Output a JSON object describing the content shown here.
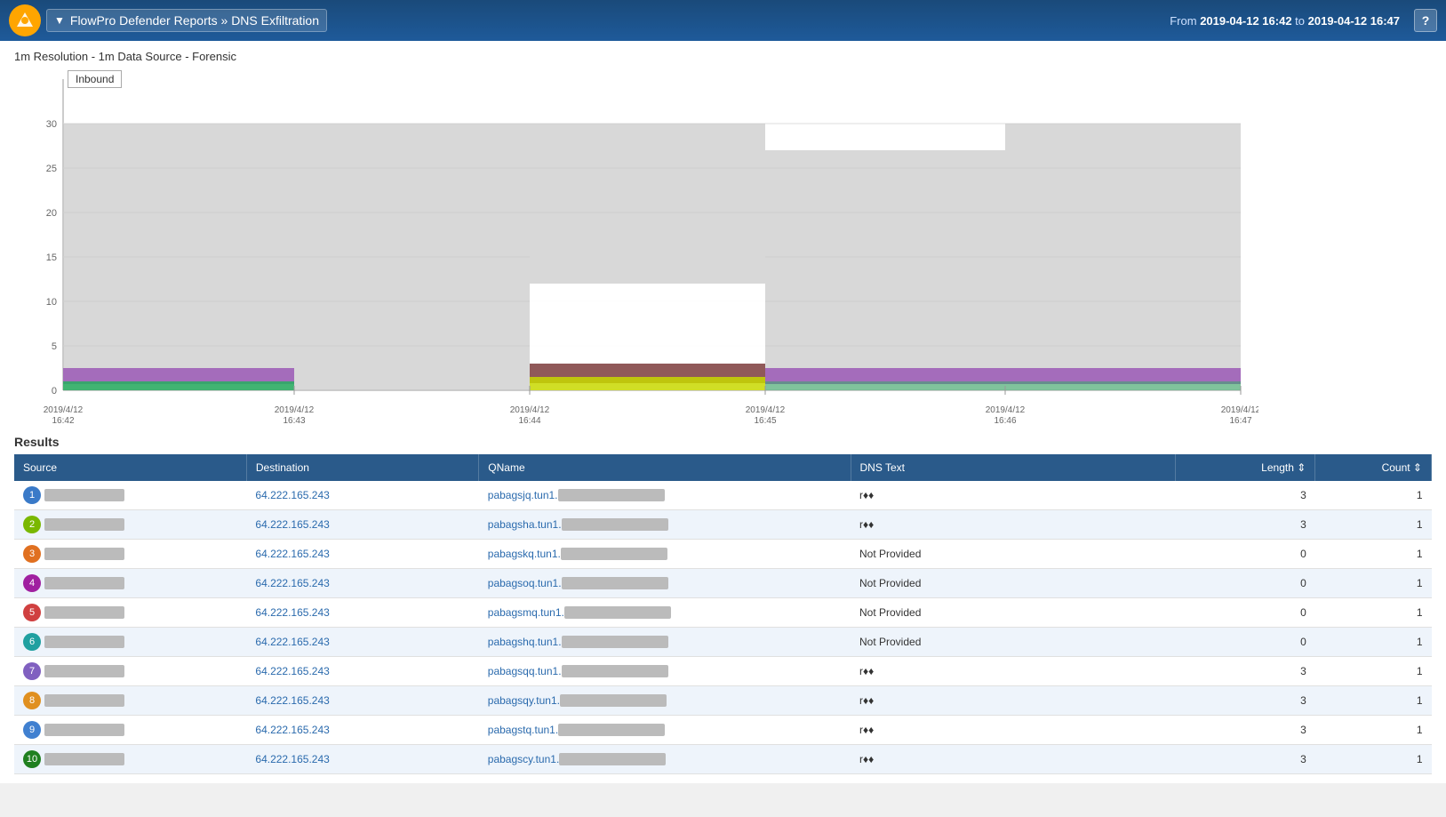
{
  "header": {
    "title": "FlowPro Defender Reports » DNS Exfiltration",
    "time_prefix": "From",
    "time_from": "2019-04-12 16:42",
    "time_to": "2019-04-12 16:47",
    "help_label": "?",
    "dropdown_icon": "▼"
  },
  "chart": {
    "resolution_label": "1m Resolution - 1m Data Source - Forensic",
    "legend_label": "Inbound",
    "y_labels": [
      "0",
      "5",
      "10",
      "15",
      "20",
      "25",
      "30"
    ],
    "x_labels": [
      "2019/4/12\n16:42",
      "2019/4/12\n16:43",
      "2019/4/12\n16:44",
      "2019/4/12\n16:45",
      "2019/4/12\n16:46",
      "2019/4/12\n16:47"
    ]
  },
  "results": {
    "section_label": "Results",
    "columns": [
      "Source",
      "Destination",
      "QName",
      "DNS Text",
      "Length",
      "Count"
    ],
    "rows": [
      {
        "num": 1,
        "source": "[redacted]",
        "destination": "64.222.165.243",
        "qname": "pabagsjq.tun1.[redacted]",
        "dns_text": "r♦♦",
        "length": "3",
        "count": "1",
        "color": "#3a7ac8"
      },
      {
        "num": 2,
        "source": "[redacted]",
        "destination": "64.222.165.243",
        "qname": "pabagsha.tun1.[redacted]",
        "dns_text": "r♦♦",
        "length": "3",
        "count": "1",
        "color": "#7ab800"
      },
      {
        "num": 3,
        "source": "[redacted]",
        "destination": "64.222.165.243",
        "qname": "pabagskq.tun1.[redacted]",
        "dns_text": "Not Provided",
        "length": "0",
        "count": "1",
        "color": "#e07020"
      },
      {
        "num": 4,
        "source": "[redacted]",
        "destination": "64.222.165.243",
        "qname": "pabagsоq.tun1.[redacted]",
        "dns_text": "Not Provided",
        "length": "0",
        "count": "1",
        "color": "#a020a0"
      },
      {
        "num": 5,
        "source": "[redacted]",
        "destination": "64.222.165.243",
        "qname": "pabagsmq.tun1.[redacted]",
        "dns_text": "Not Provided",
        "length": "0",
        "count": "1",
        "color": "#d04040"
      },
      {
        "num": 6,
        "source": "[redacted]",
        "destination": "64.222.165.243",
        "qname": "pabagshq.tun1.[redacted]",
        "dns_text": "Not Provided",
        "length": "0",
        "count": "1",
        "color": "#20a0a0"
      },
      {
        "num": 7,
        "source": "[redacted]",
        "destination": "64.222.165.243",
        "qname": "pabagsqq.tun1.[redacted]",
        "dns_text": "r♦♦",
        "length": "3",
        "count": "1",
        "color": "#8060c0"
      },
      {
        "num": 8,
        "source": "[redacted]",
        "destination": "64.222.165.243",
        "qname": "pabagsqy.tun1.[redacted]",
        "dns_text": "r♦♦",
        "length": "3",
        "count": "1",
        "color": "#e09020"
      },
      {
        "num": 9,
        "source": "[redacted]",
        "destination": "64.222.165.243",
        "qname": "pabagstq.tun1.[redacted]",
        "dns_text": "r♦♦",
        "length": "3",
        "count": "1",
        "color": "#4080d0"
      },
      {
        "num": 10,
        "source": "[redacted]",
        "destination": "64.222.165.243",
        "qname": "pabagscy.tun1.[redacted]",
        "dns_text": "r♦♦",
        "length": "3",
        "count": "1",
        "color": "#208020"
      }
    ]
  }
}
